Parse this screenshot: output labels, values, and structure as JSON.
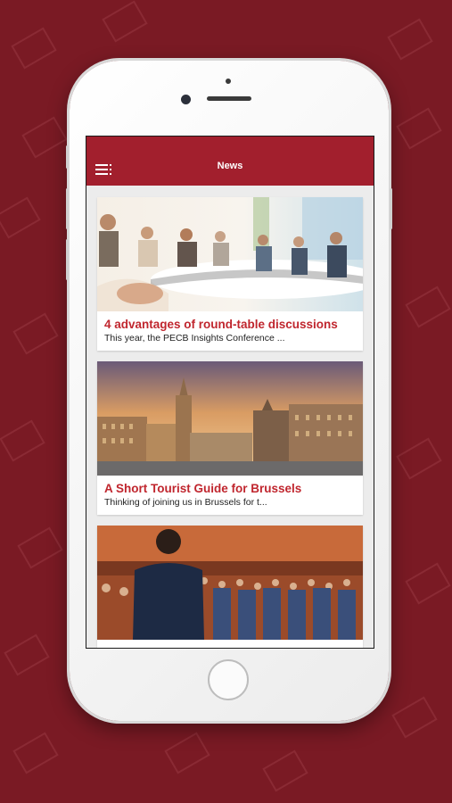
{
  "navbar": {
    "title": "News",
    "menu_icon": "hamburger-menu-icon",
    "color": "#a21f2d"
  },
  "feed": {
    "articles": [
      {
        "title": "4 advantages of round-table discussions",
        "excerpt": "This year, the PECB Insights Conference ..."
      },
      {
        "title": "A Short Tourist Guide for Brussels",
        "excerpt": "Thinking of joining us in Brussels for t..."
      },
      {
        "title": "",
        "excerpt": ""
      }
    ]
  },
  "colors": {
    "background": "#7a1a24",
    "accent": "#c0262e"
  }
}
